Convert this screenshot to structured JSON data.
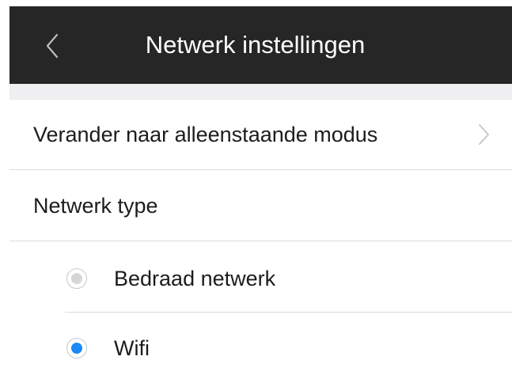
{
  "colors": {
    "header_bg": "#262626",
    "header_text": "#ffffff",
    "section_gap": "#efeff1",
    "divider": "#dcdcdc",
    "radio_selected": "#1e88f4",
    "radio_unselected": "#d6d6d6"
  },
  "header": {
    "back_icon": "chevron-left-icon",
    "title": "Netwerk instellingen"
  },
  "rows": {
    "standalone_mode": {
      "label": "Verander naar alleenstaande modus",
      "icon": "chevron-right-icon"
    },
    "network_type": {
      "label": "Netwerk type"
    }
  },
  "network_options": [
    {
      "label": "Bedraad netwerk",
      "selected": false
    },
    {
      "label": "Wifi",
      "selected": true
    }
  ]
}
